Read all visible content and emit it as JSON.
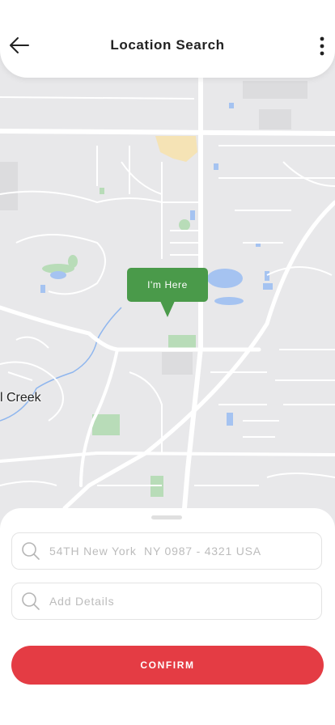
{
  "header": {
    "title": "Location Search",
    "back_icon": "arrow-left-icon",
    "menu_icon": "more-vertical-icon"
  },
  "map": {
    "marker_label": "I'm Here",
    "place_label": "l Creek",
    "marker_color": "#4a9a4a"
  },
  "sheet": {
    "address_field": {
      "value": "54TH New York  NY 0987 - 4321 USA",
      "icon": "search-icon"
    },
    "details_field": {
      "placeholder": "Add Details",
      "icon": "search-icon"
    },
    "confirm_label": "CONFIRM",
    "confirm_color": "#e43c44"
  }
}
